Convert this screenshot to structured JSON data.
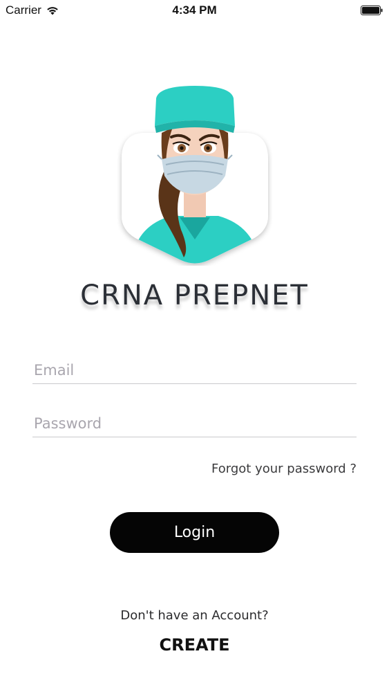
{
  "status_bar": {
    "carrier": "Carrier",
    "time": "4:34 PM",
    "wifi_icon": "wifi-icon",
    "battery_icon": "battery-icon"
  },
  "logo": {
    "brand_text": "CRNA PREPNET",
    "image_icon": "nurse-avatar-icon"
  },
  "form": {
    "email_placeholder": "Email",
    "email_value": "",
    "password_placeholder": "Password",
    "password_value": "",
    "forgot_label": "Forgot your password ?",
    "login_label": "Login"
  },
  "footer": {
    "no_account_text": "Don't have an Account?",
    "create_label": "CREATE"
  },
  "colors": {
    "button_bg": "#050505",
    "scrub_teal": "#2ccfc3",
    "brand_text": "#2b2f36"
  }
}
